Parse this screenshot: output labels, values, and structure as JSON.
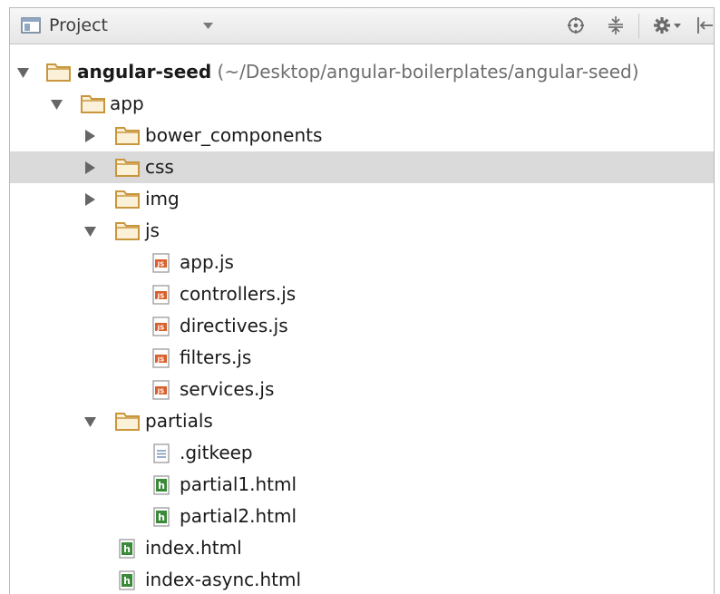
{
  "toolbar": {
    "view_label": "Project",
    "buttons": [
      "locate-icon",
      "collapse-all-icon",
      "gear-icon",
      "hide-panel-icon"
    ]
  },
  "tree": {
    "root_name": "angular-seed",
    "root_path": "(~/Desktop/angular-boilerplates/angular-seed)",
    "app": "app",
    "bower_components": "bower_components",
    "css": "css",
    "img": "img",
    "js": "js",
    "js_files": [
      "app.js",
      "controllers.js",
      "directives.js",
      "filters.js",
      "services.js"
    ],
    "partials": "partials",
    "partials_files": [
      ".gitkeep",
      "partial1.html",
      "partial2.html"
    ],
    "root_files": [
      "index.html",
      "index-async.html"
    ]
  },
  "colors": {
    "folder": "#c9963c",
    "js_icon": "#d9602c",
    "html_icon": "#3a8a3a",
    "selection": "#dadada"
  }
}
